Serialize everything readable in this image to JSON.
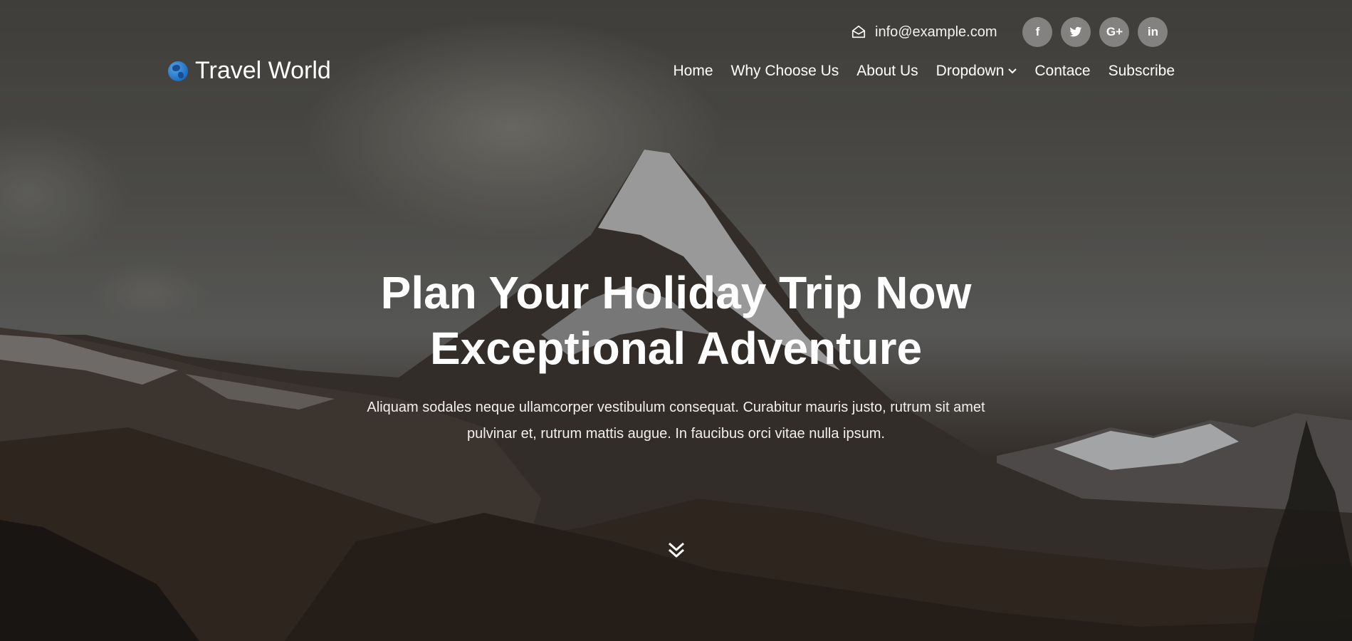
{
  "topbar": {
    "email": "info@example.com",
    "email_icon": "envelope-open-icon",
    "socials": [
      {
        "name": "facebook-icon",
        "glyph": "f"
      },
      {
        "name": "twitter-icon",
        "glyph": "t"
      },
      {
        "name": "google-plus-icon",
        "glyph": "G+"
      },
      {
        "name": "linkedin-icon",
        "glyph": "in"
      }
    ]
  },
  "brand": {
    "name": "Travel World",
    "logo_icon": "globe-icon",
    "logo_color": "#2a7fd4"
  },
  "nav": {
    "items": [
      {
        "label": "Home"
      },
      {
        "label": "Why Choose Us"
      },
      {
        "label": "About Us"
      },
      {
        "label": "Dropdown",
        "icon": "chevron-down-icon"
      },
      {
        "label": "Contace"
      },
      {
        "label": "Subscribe"
      }
    ]
  },
  "hero": {
    "title_line1": "Plan Your Holiday Trip Now",
    "title_line2": "Exceptional Adventure",
    "subtitle_line1": "Aliquam sodales neque ullamcorper vestibulum consequat. Curabitur mauris justo, rutrum sit amet",
    "subtitle_line2": "pulvinar et, rutrum mattis augue. In faucibus orci vitae nulla ipsum.",
    "scroll_icon": "double-chevron-down-icon"
  }
}
